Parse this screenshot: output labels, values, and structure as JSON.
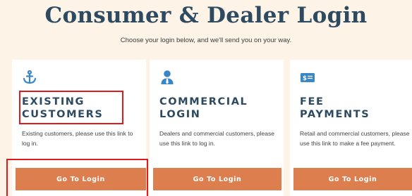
{
  "page": {
    "title": "Consumer & Dealer Login",
    "subtitle": "Choose your login below, and we'll send you on your way."
  },
  "cards": [
    {
      "icon": "anchor-icon",
      "title_line1": "EXISTING",
      "title_line2": "CUSTOMERS",
      "description": "Existing customers, please use this link to log in.",
      "button_label": "Go To Login"
    },
    {
      "icon": "person-with-tie-icon",
      "title_line1": "COMMERCIAL",
      "title_line2": "LOGIN",
      "description": "Dealers and commercial customers, please use this link to log in.",
      "button_label": "Go To Login"
    },
    {
      "icon": "dollar-bill-icon",
      "title_line1": "FEE",
      "title_line2": "PAYMENTS",
      "description": "Retail and commercial customers, please use this link to make a fee payment.",
      "button_label": "Go To Login"
    }
  ],
  "colors": {
    "background": "#fdf3e7",
    "title": "#2d4a60",
    "icon": "#3a87c6",
    "button": "#dd7e4e",
    "highlight": "#e01b1b"
  }
}
